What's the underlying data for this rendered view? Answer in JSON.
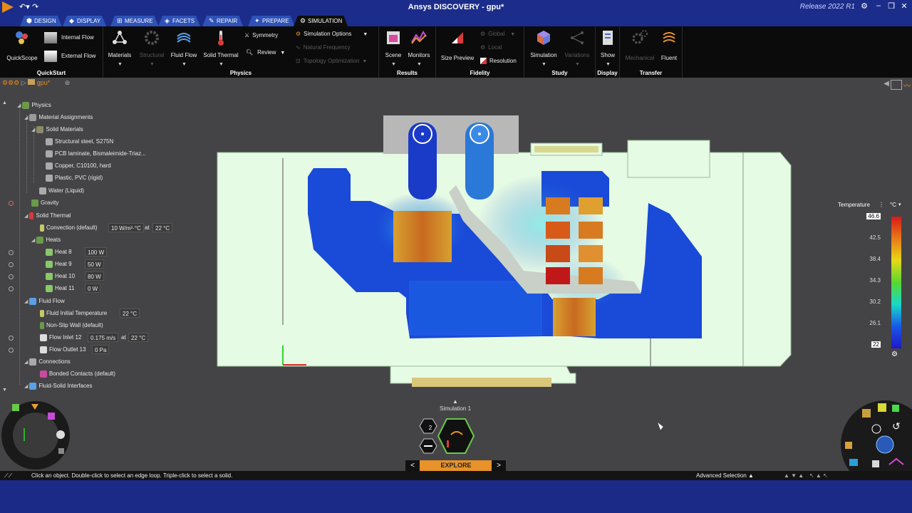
{
  "app": {
    "title": "Ansys DISCOVERY - gpu*",
    "release": "Release 2022 R1"
  },
  "tabs": [
    {
      "label": "Design"
    },
    {
      "label": "Display"
    },
    {
      "label": "Measure"
    },
    {
      "label": "Facets"
    },
    {
      "label": "Repair"
    },
    {
      "label": "Prepare"
    },
    {
      "label": "Simulation"
    }
  ],
  "ribbon": {
    "quickstart": {
      "label": "QuickStart",
      "quickscope": "QuickScope",
      "internal_flow": "Internal Flow",
      "external_flow": "External Flow"
    },
    "physics": {
      "label": "Physics",
      "materials": "Materials",
      "structural": "Structural",
      "fluid_flow": "Fluid Flow",
      "solid_thermal": "Solid Thermal",
      "symmetry": "Symmetry",
      "review": "Review",
      "simulation_options": "Simulation Options",
      "natural_frequency": "Natural Frequency",
      "topology_optimization": "Topology Optimization"
    },
    "results": {
      "label": "Results",
      "scene": "Scene",
      "monitors": "Monitors"
    },
    "fidelity": {
      "label": "Fidelity",
      "size_preview": "Size Preview",
      "global": "Global",
      "local": "Local",
      "resolution": "Resolution"
    },
    "study": {
      "label": "Study",
      "simulation": "Simulation",
      "variations": "Variations"
    },
    "display": {
      "label": "Display",
      "show": "Show"
    },
    "transfer": {
      "label": "Transfer",
      "mechanical": "Mechanical",
      "fluent": "Fluent"
    }
  },
  "breadcrumb": {
    "doc": "gpu*"
  },
  "tree": {
    "physics": "Physics",
    "material_assignments": "Material Assignments",
    "solid_materials": "Solid Materials",
    "mat1": "Structural steel, S275N",
    "mat2": "PCB laminate, Bismaleimide-Triaz...",
    "mat3": "Copper, C10100, hard",
    "mat4": "Plastic, PVC (rigid)",
    "water": "Water (Liquid)",
    "gravity": "Gravity",
    "solid_thermal": "Solid Thermal",
    "convection": "Convection (default)",
    "convection_val": "10 W/m²·°C",
    "at": "at",
    "convection_temp": "22 °C",
    "heats": "Heats",
    "heat8": "Heat 8",
    "heat8_val": "100 W",
    "heat9": "Heat 9",
    "heat9_val": "50 W",
    "heat10": "Heat 10",
    "heat10_val": "80 W",
    "heat11": "Heat 11",
    "heat11_val": "0 W",
    "fluid_flow": "Fluid Flow",
    "fluid_init": "Fluid Initial Temperature",
    "fluid_init_val": "22 °C",
    "nonslip": "Non-Slip Wall (default)",
    "inlet": "Flow Inlet 12",
    "inlet_val": "0.175 m/s",
    "inlet_temp": "22 °C",
    "outlet": "Flow Outlet 13",
    "outlet_val": "0 Pa",
    "connections": "Connections",
    "bonded": "Bonded Contacts (default)",
    "fsi": "Fluid-Solid Interfaces"
  },
  "legend": {
    "title": "Temperature",
    "unit": "°C",
    "ticks": [
      "46.6",
      "42.5",
      "38.4",
      "34.3",
      "30.2",
      "26.1",
      "22"
    ]
  },
  "simulation": {
    "label": "Simulation 1",
    "count": "2",
    "explore": "EXPLORE"
  },
  "status": {
    "hint": "Click an object. Double-click to select an edge loop. Triple-click to select a solid.",
    "advanced": "Advanced Selection"
  },
  "colors": {
    "title_bg": "#1b2c8a",
    "ribbon_bg": "#0b0b0b",
    "viewport": "#444446",
    "accent": "#e8922a",
    "tab_active": "#0e0e0e"
  }
}
